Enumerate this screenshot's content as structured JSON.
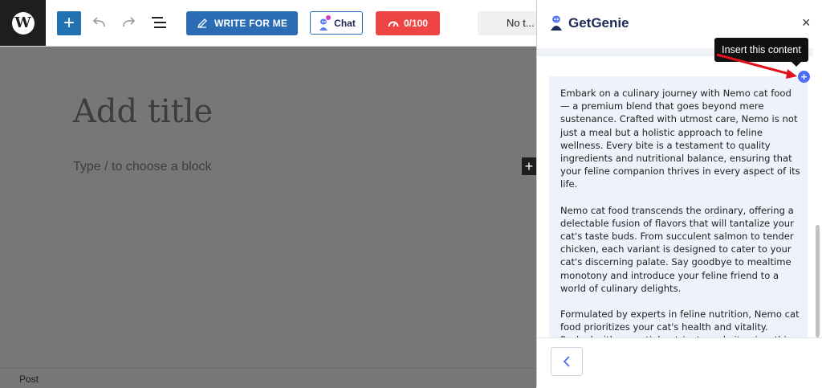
{
  "toolbar": {
    "add_label": "+",
    "write_label": "WRITE FOR ME",
    "chat_label": "Chat",
    "score_label": "0/100",
    "notice_label": "No t..."
  },
  "editor": {
    "title_placeholder": "Add title",
    "block_placeholder": "Type / to choose a block",
    "inserter_label": "+"
  },
  "statusbar": {
    "label": "Post"
  },
  "panel": {
    "brand": "GetGenie",
    "close_label": "×",
    "tooltip": "Insert this content",
    "insert_label": "+",
    "content": [
      "Embark on a culinary journey with Nemo cat food — a premium blend that goes beyond mere sustenance. Crafted with utmost care, Nemo is not just a meal but a holistic approach to feline wellness. Every bite is a testament to quality ingredients and nutritional balance, ensuring that your feline companion thrives in every aspect of its life.",
      "Nemo cat food transcends the ordinary, offering a delectable fusion of flavors that will tantalize your cat's taste buds. From succulent salmon to tender chicken, each variant is designed to cater to your cat's discerning palate. Say goodbye to mealtime monotony and introduce your feline friend to a world of culinary delights.",
      "Formulated by experts in feline nutrition, Nemo cat food prioritizes your cat's health and vitality. Packed with essential nutrients and vitamins, this premium food supports your cat's overall well-being, from a"
    ]
  },
  "colors": {
    "wp_blue": "#2271b1",
    "genie_blue": "#2a6db4",
    "score_red": "#ef4444",
    "editor_overlay": "#777777",
    "content_bg": "#eef2fb",
    "arrow_red": "#e0121b"
  },
  "icons": {
    "logo": "wordpress-icon",
    "undo": "undo-icon",
    "redo": "redo-icon",
    "list": "list-view-icon",
    "pen": "pen-icon",
    "chat": "genie-chat-icon",
    "gauge": "gauge-icon",
    "back": "chevron-left-icon"
  }
}
